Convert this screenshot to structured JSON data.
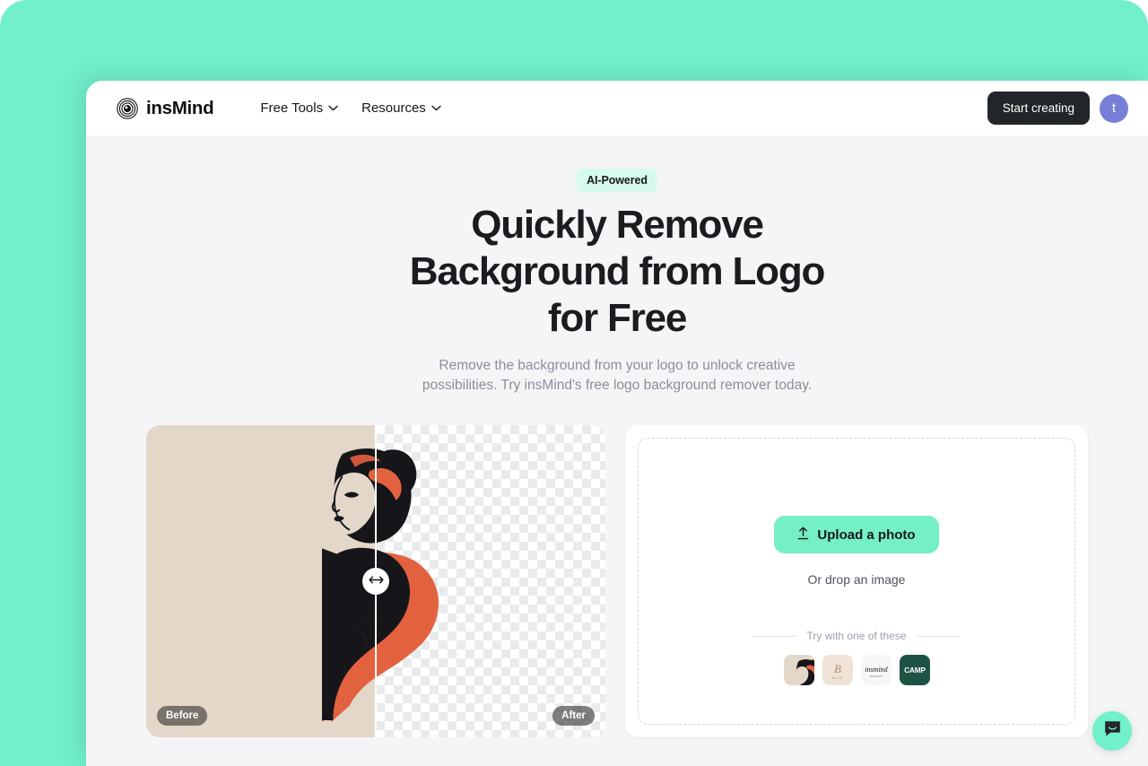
{
  "page": {
    "outer_background": "#71F0CB",
    "app_background": "#F4F5F7"
  },
  "header": {
    "brand": "insMind",
    "brand_icon": "concentric-rings-logo",
    "nav": [
      {
        "label": "Free Tools",
        "icon": "chevron-down-icon"
      },
      {
        "label": "Resources",
        "icon": "chevron-down-icon"
      }
    ],
    "cta_label": "Start creating",
    "cta_color": "#22252A",
    "avatar_initial": "t",
    "avatar_color": "#7680D8"
  },
  "hero": {
    "badge": "AI-Powered",
    "badge_color": "#D6FBEE",
    "title_lines": [
      "Quickly Remove",
      "Background from Logo",
      "for Free"
    ],
    "subtitle_lines": [
      "Remove the background from your logo to unlock creative",
      "possibilities. Try insMind's free logo background remover today."
    ]
  },
  "comparison": {
    "before_label": "Before",
    "after_label": "After",
    "before_background": "#E3D7C9",
    "slider_icon": "left-right-arrow-icon",
    "slider_position_percent": 50
  },
  "upload": {
    "button_label": "Upload a photo",
    "button_icon": "upload-arrow-icon",
    "button_color": "#75EFC4",
    "drop_hint": "Or drop an image",
    "try_label": "Try with one of these",
    "samples": [
      {
        "name": "woman-illustration-thumb",
        "background": "#E3D7C9"
      },
      {
        "name": "b-monogram-thumb",
        "background": "#EFE3D8",
        "text": "B",
        "caption": "BLUE"
      },
      {
        "name": "insmind-script-thumb",
        "background": "#F7F7F5",
        "text": "insmind",
        "caption": "DESIGN"
      },
      {
        "name": "camp-logo-thumb",
        "background": "#1E5245",
        "text": "CAMP"
      }
    ]
  },
  "chat": {
    "icon": "chat-bubble-icon",
    "color": "#71F0CB"
  }
}
